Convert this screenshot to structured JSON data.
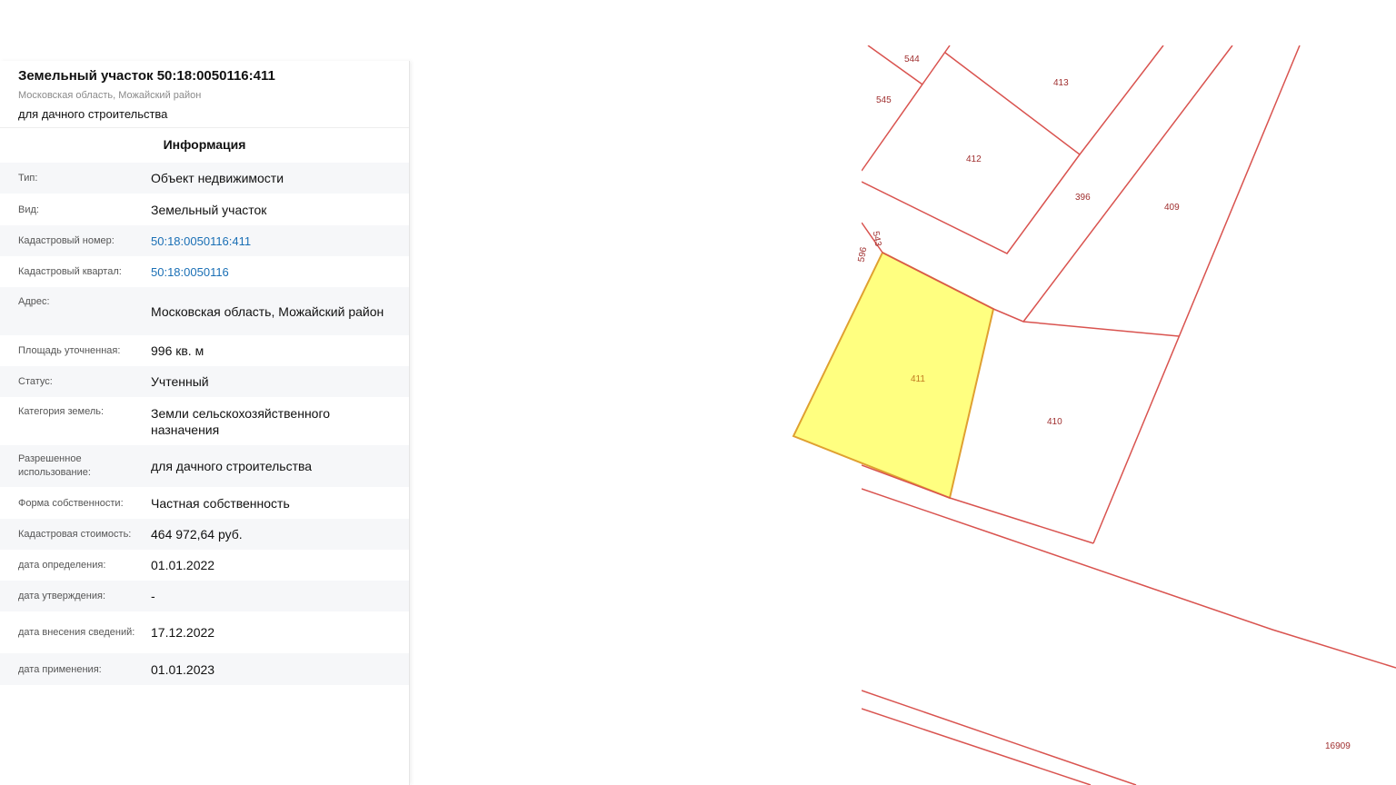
{
  "header": {
    "title": "Земельный участок 50:18:0050116:411",
    "address": "Московская область, Можайский район",
    "use": "для дачного строительства"
  },
  "section_title": "Информация",
  "rows": [
    {
      "key": "Тип:",
      "value": "Объект недвижимости"
    },
    {
      "key": "Вид:",
      "value": "Земельный участок"
    },
    {
      "key": "Кадастровый номер:",
      "value": "50:18:0050116:411"
    },
    {
      "key": "Кадастровый квартал:",
      "value": "50:18:0050116"
    },
    {
      "key": "Адрес:",
      "value": "Московская область, Можайский район"
    },
    {
      "key": "Площадь уточненная:",
      "value": "996 кв. м"
    },
    {
      "key": "Статус:",
      "value": "Учтенный"
    },
    {
      "key": "Категория земель:",
      "value": "Земли сельскохозяйственного назначения"
    },
    {
      "key": "Разрешенное использование:",
      "value": "для дачного строительства"
    },
    {
      "key": "Форма собственности:",
      "value": "Частная собственность"
    },
    {
      "key": "Кадастровая стоимость:",
      "value": "464 972,64 руб."
    },
    {
      "key": "дата определения:",
      "value": "01.01.2022"
    },
    {
      "key": "дата утверждения:",
      "value": "-"
    },
    {
      "key": "дата внесения сведений:",
      "value": "17.12.2022"
    },
    {
      "key": "дата применения:",
      "value": "01.01.2023"
    }
  ],
  "map": {
    "parcel_labels": [
      "544",
      "545",
      "413",
      "412",
      "396",
      "409",
      "543",
      "596",
      "411",
      "410",
      "16909"
    ],
    "colors": {
      "boundary": "#d9534f",
      "selected_fill": "#ffff80",
      "selected_stroke": "#e0a030"
    }
  }
}
